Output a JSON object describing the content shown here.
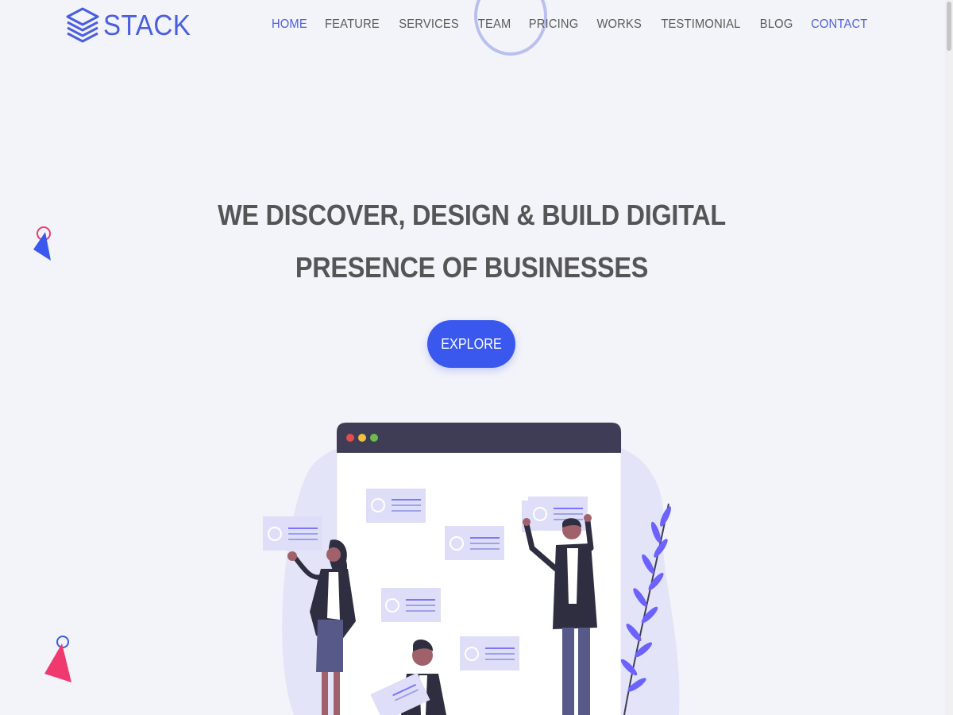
{
  "brand": {
    "name": "STACK"
  },
  "nav": {
    "items": [
      {
        "label": "HOME",
        "state": "active"
      },
      {
        "label": "FEATURE",
        "state": "normal"
      },
      {
        "label": "SERVICES",
        "state": "normal"
      },
      {
        "label": "TEAM",
        "state": "normal"
      },
      {
        "label": "PRICING",
        "state": "normal"
      },
      {
        "label": "WORKS",
        "state": "normal"
      },
      {
        "label": "TESTIMONIAL",
        "state": "normal"
      },
      {
        "label": "BLOG",
        "state": "normal"
      },
      {
        "label": "CONTACT",
        "state": "highlight"
      }
    ]
  },
  "hero": {
    "title_line1": "WE DISCOVER, DESIGN & BUILD DIGITAL",
    "title_line2": "PRESENCE OF BUSINESSES",
    "cta_label": "EXPLORE"
  },
  "colors": {
    "accent": "#3a58ee",
    "nav_active": "#4d5fe0",
    "text": "#555555",
    "background": "#f3f4f9",
    "browser_bar": "#3f3d56",
    "dot_red": "#e34d4d",
    "dot_yellow": "#f0c040",
    "dot_green": "#6dbb4a",
    "pink": "#f0396e",
    "leaf": "#6c63ff"
  }
}
